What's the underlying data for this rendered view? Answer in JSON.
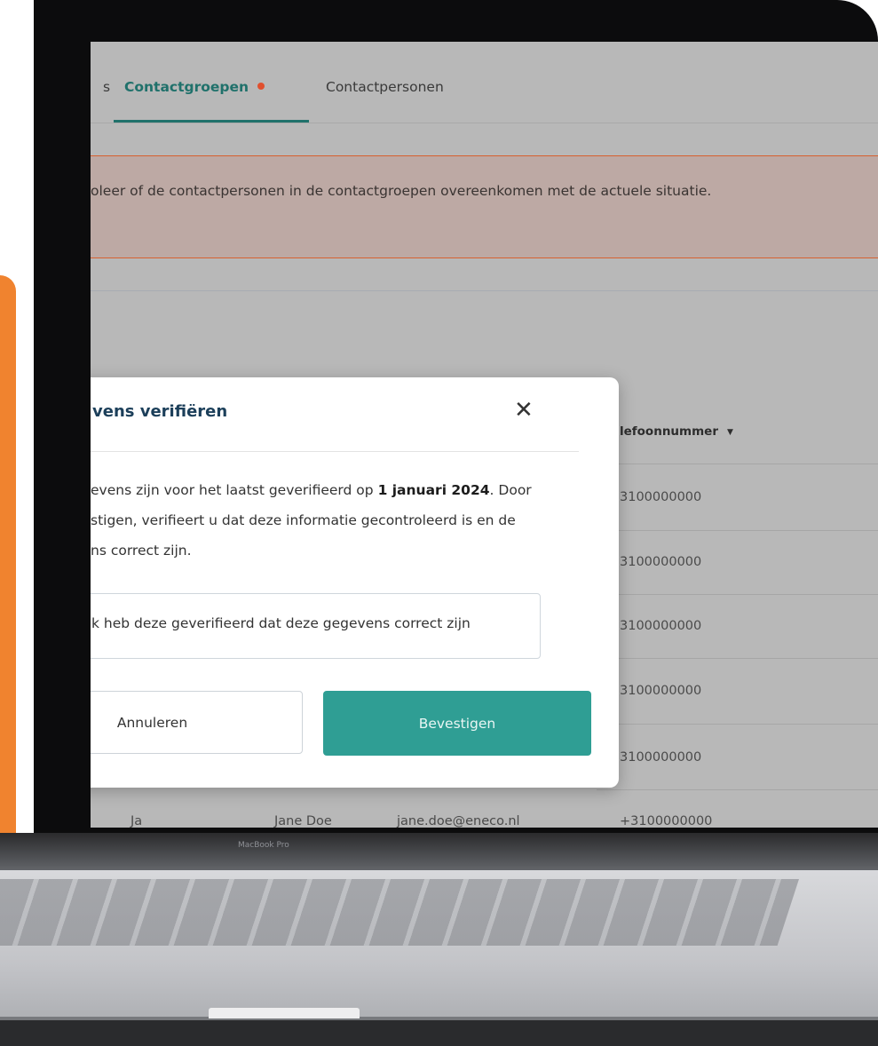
{
  "tabs": {
    "previous_partial": "s",
    "active": "Contactgroepen",
    "contacts": "Contactpersonen"
  },
  "alert": {
    "text": "oleer of de contactpersonen in de contactgroepen overeenkomen met de actuele situatie."
  },
  "table": {
    "phone_header": "lefoonnummer",
    "phone_values": [
      "3100000000",
      "3100000000",
      "3100000000",
      "3100000000",
      "3100000000"
    ],
    "last_row": {
      "col1": "Ja",
      "name": "Jane Doe",
      "email": "jane.doe@eneco.nl",
      "phone": "+3100000000"
    }
  },
  "modal": {
    "title": "vens verifiëren",
    "body_line1_pre": "evens zijn voor het laatst geverifieerd op ",
    "body_date": "1 januari 2024",
    "body_line1_post": ". Door",
    "body_line2": "stigen, verifieert u dat deze informatie gecontroleerd is en de",
    "body_line3": "ns correct zijn.",
    "confirm_text": "k heb deze geverifieerd dat deze gegevens correct zijn",
    "cancel_label": "Annuleren",
    "confirm_label": "Bevestigen"
  },
  "device": {
    "hinge_label": "MacBook Pro"
  },
  "colors": {
    "accent_orange": "#f0832f",
    "teal": "#2f9e94",
    "active_tab": "#20716b",
    "alert_dot": "#e0502e"
  }
}
